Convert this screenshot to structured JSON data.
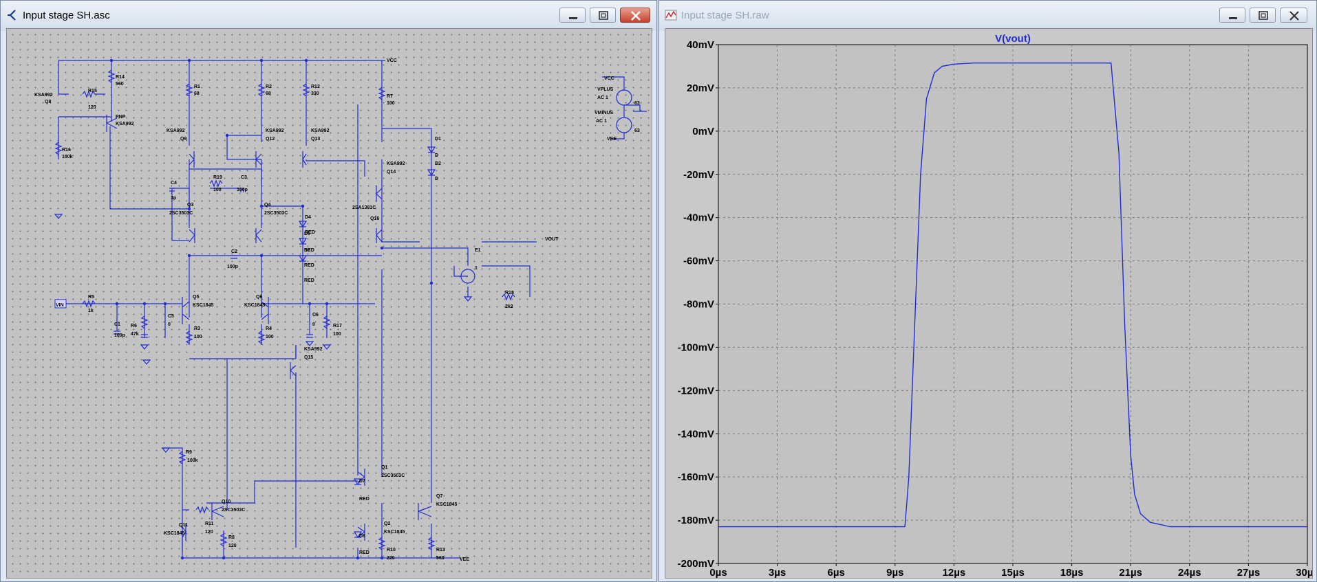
{
  "schematic_window": {
    "title": "Input stage SH.asc",
    "labels": [
      {
        "id": "r14",
        "text": "R14"
      },
      {
        "id": "r14v",
        "text": "560"
      },
      {
        "id": "r15",
        "text": "R15"
      },
      {
        "id": "r15v",
        "text": "120"
      },
      {
        "id": "q8m",
        "text": "KSA992"
      },
      {
        "id": "q8",
        "text": "Q8"
      },
      {
        "id": "pnp",
        "text": "PNP"
      },
      {
        "id": "pnpm",
        "text": "KSA992"
      },
      {
        "id": "r16",
        "text": "R16"
      },
      {
        "id": "r16v",
        "text": "100k"
      },
      {
        "id": "r1",
        "text": "R1"
      },
      {
        "id": "r1v",
        "text": "68"
      },
      {
        "id": "r2",
        "text": "R2"
      },
      {
        "id": "r2v",
        "text": "68"
      },
      {
        "id": "r12",
        "text": "R12"
      },
      {
        "id": "r12v",
        "text": "330"
      },
      {
        "id": "r7",
        "text": "R7"
      },
      {
        "id": "r7v",
        "text": "100"
      },
      {
        "id": "vcc",
        "text": "VCC"
      },
      {
        "id": "q9m",
        "text": "KSA992"
      },
      {
        "id": "q9",
        "text": "Q9"
      },
      {
        "id": "q12m",
        "text": "KSA992"
      },
      {
        "id": "q12",
        "text": "Q12"
      },
      {
        "id": "q13m",
        "text": "KSA992"
      },
      {
        "id": "q13",
        "text": "Q13"
      },
      {
        "id": "d1",
        "text": "D1"
      },
      {
        "id": "d1v",
        "text": "D"
      },
      {
        "id": "d2",
        "text": "D2"
      },
      {
        "id": "d2v",
        "text": "D"
      },
      {
        "id": "q14m",
        "text": "KSA992"
      },
      {
        "id": "q14",
        "text": "Q14"
      },
      {
        "id": "c4",
        "text": "C4"
      },
      {
        "id": "c4v",
        "text": "3p"
      },
      {
        "id": "r19",
        "text": "R19"
      },
      {
        "id": "r19v",
        "text": "100"
      },
      {
        "id": "c3",
        "text": "C3"
      },
      {
        "id": "c3v",
        "text": "100p"
      },
      {
        "id": "q3",
        "text": "Q3"
      },
      {
        "id": "q3m",
        "text": "2SC3503C"
      },
      {
        "id": "q4",
        "text": "Q4"
      },
      {
        "id": "q4m",
        "text": "2SC3503C"
      },
      {
        "id": "d4",
        "text": "D4"
      },
      {
        "id": "red1",
        "text": "RED"
      },
      {
        "id": "d5",
        "text": "D5"
      },
      {
        "id": "red2",
        "text": "RED"
      },
      {
        "id": "d6",
        "text": "D6"
      },
      {
        "id": "red3",
        "text": "RED"
      },
      {
        "id": "red4",
        "text": "RED"
      },
      {
        "id": "q16m",
        "text": "2SA1381C"
      },
      {
        "id": "q16",
        "text": "Q16"
      },
      {
        "id": "e1",
        "text": "E1"
      },
      {
        "id": "e1v",
        "text": "1"
      },
      {
        "id": "vout",
        "text": "VOUT"
      },
      {
        "id": "c2",
        "text": "C2"
      },
      {
        "id": "c2v",
        "text": "100p"
      },
      {
        "id": "vin",
        "text": "VIN"
      },
      {
        "id": "r5",
        "text": "R5"
      },
      {
        "id": "r5v",
        "text": "1k"
      },
      {
        "id": "q5",
        "text": "Q5"
      },
      {
        "id": "q5m",
        "text": "KSC1845"
      },
      {
        "id": "q6",
        "text": "Q6"
      },
      {
        "id": "q6m",
        "text": "KSC1845"
      },
      {
        "id": "c5",
        "text": "C5"
      },
      {
        "id": "c5v",
        "text": "0"
      },
      {
        "id": "c1",
        "text": "C1"
      },
      {
        "id": "c1v",
        "text": "100p"
      },
      {
        "id": "r6",
        "text": "R6"
      },
      {
        "id": "r6v",
        "text": "47k"
      },
      {
        "id": "r3",
        "text": "R3"
      },
      {
        "id": "r3v",
        "text": "100"
      },
      {
        "id": "r4",
        "text": "R4"
      },
      {
        "id": "r4v",
        "text": "100"
      },
      {
        "id": "c6",
        "text": "C6"
      },
      {
        "id": "c6v",
        "text": "0"
      },
      {
        "id": "r17",
        "text": "R17"
      },
      {
        "id": "r17v",
        "text": "100"
      },
      {
        "id": "r18",
        "text": "R18"
      },
      {
        "id": "r18v",
        "text": "2k2"
      },
      {
        "id": "q15m",
        "text": "KSA992"
      },
      {
        "id": "q15",
        "text": "Q15"
      },
      {
        "id": "r9",
        "text": "R9"
      },
      {
        "id": "r9v",
        "text": "100k"
      },
      {
        "id": "q10",
        "text": "Q10"
      },
      {
        "id": "q10m",
        "text": "2SC3503C"
      },
      {
        "id": "q11",
        "text": "Q11"
      },
      {
        "id": "q11m",
        "text": "KSC1845"
      },
      {
        "id": "r11",
        "text": "R11"
      },
      {
        "id": "r11v",
        "text": "120"
      },
      {
        "id": "r8",
        "text": "R8"
      },
      {
        "id": "r8v",
        "text": "120"
      },
      {
        "id": "q1",
        "text": "Q1"
      },
      {
        "id": "q1m",
        "text": "2SC3503C"
      },
      {
        "id": "d7",
        "text": "D7"
      },
      {
        "id": "red5",
        "text": "RED"
      },
      {
        "id": "q2",
        "text": "Q2"
      },
      {
        "id": "q2m",
        "text": "KSC1845"
      },
      {
        "id": "d8",
        "text": "D8"
      },
      {
        "id": "red6",
        "text": "RED"
      },
      {
        "id": "r10",
        "text": "R10"
      },
      {
        "id": "r10v",
        "text": "220"
      },
      {
        "id": "q7",
        "text": "Q7"
      },
      {
        "id": "q7m",
        "text": "KSC1845"
      },
      {
        "id": "r13",
        "text": "R13"
      },
      {
        "id": "r13v",
        "text": "560"
      },
      {
        "id": "vee",
        "text": "VEE"
      },
      {
        "id": "vcc2",
        "text": "VCC"
      },
      {
        "id": "vplus",
        "text": "VPLUS"
      },
      {
        "id": "ac1a",
        "text": "AC 1"
      },
      {
        "id": "v63a",
        "text": "63"
      },
      {
        "id": "vminus",
        "text": "VMINUS"
      },
      {
        "id": "ac1b",
        "text": "AC 1"
      },
      {
        "id": "v63b",
        "text": "63"
      },
      {
        "id": "vee2",
        "text": "VEE"
      }
    ]
  },
  "waveform_window": {
    "title": "Input stage SH.raw",
    "trace_color": "#1f2bd6",
    "grid_color": "#7a7a7a"
  },
  "chart_data": {
    "type": "line",
    "title": "V(vout)",
    "xlabel": "",
    "ylabel": "",
    "xlim": [
      0,
      30
    ],
    "ylim": [
      -200,
      40
    ],
    "x_tick_labels": [
      "0µs",
      "3µs",
      "6µs",
      "9µs",
      "12µs",
      "15µs",
      "18µs",
      "21µs",
      "24µs",
      "27µs",
      "30µs"
    ],
    "y_tick_labels": [
      "40mV",
      "20mV",
      "0mV",
      "-20mV",
      "-40mV",
      "-60mV",
      "-80mV",
      "-100mV",
      "-120mV",
      "-140mV",
      "-160mV",
      "-180mV",
      "-200mV"
    ],
    "x_unit": "µs",
    "y_unit": "mV",
    "series": [
      {
        "x": [
          0,
          9.5,
          9.7,
          10.0,
          10.3,
          10.6,
          11.0,
          11.4,
          12.0,
          13.0,
          14.0,
          20.0,
          20.4,
          20.7,
          21.0,
          21.2,
          21.5,
          22.0,
          23.0,
          30.0
        ],
        "y": [
          -183,
          -183,
          -160,
          -90,
          -20,
          15,
          27,
          30,
          31,
          31.5,
          31.5,
          31.5,
          -10,
          -90,
          -150,
          -168,
          -177,
          -181,
          -183,
          -183
        ]
      }
    ]
  }
}
